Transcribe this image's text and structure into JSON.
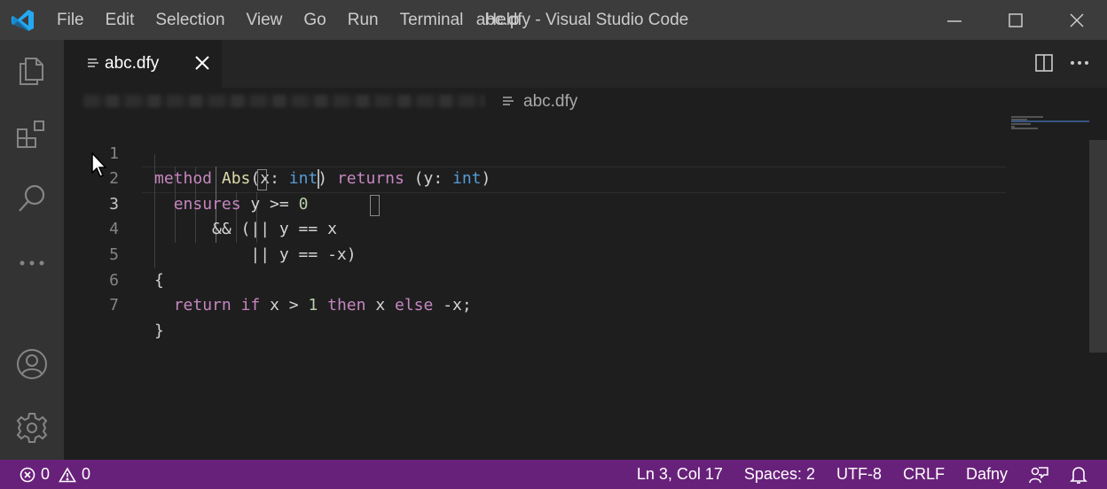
{
  "window": {
    "title": "abc.dfy - Visual Studio Code",
    "menu": [
      "File",
      "Edit",
      "Selection",
      "View",
      "Go",
      "Run",
      "Terminal",
      "Help"
    ]
  },
  "activity_bar": [
    "explorer-icon",
    "extensions-icon",
    "search-icon",
    "more-icon",
    "account-icon",
    "settings-gear-icon"
  ],
  "tab": {
    "label": "abc.dfy",
    "icon": "file-lines-icon"
  },
  "breadcrumb": {
    "file": "abc.dfy"
  },
  "editor": {
    "active_line": 3,
    "lines": [
      {
        "n": "1",
        "text": "method Abs(x: int) returns (y: int)"
      },
      {
        "n": "2",
        "text": "  ensures y >= 0"
      },
      {
        "n": "3",
        "text": "      && (|| y == x"
      },
      {
        "n": "4",
        "text": "          || y == -x)"
      },
      {
        "n": "5",
        "text": "{"
      },
      {
        "n": "6",
        "text": "  return if x > 1 then x else -x;"
      },
      {
        "n": "7",
        "text": "}"
      }
    ]
  },
  "status": {
    "errors": "0",
    "warnings": "0",
    "position": "Ln 3, Col 17",
    "spaces": "Spaces: 2",
    "encoding": "UTF-8",
    "eol": "CRLF",
    "language": "Dafny"
  },
  "colors": {
    "statusbar": "#68217a",
    "titlebar": "#3c3c3c",
    "editor_bg": "#1e1e1e",
    "keyword": "#c586c0"
  }
}
